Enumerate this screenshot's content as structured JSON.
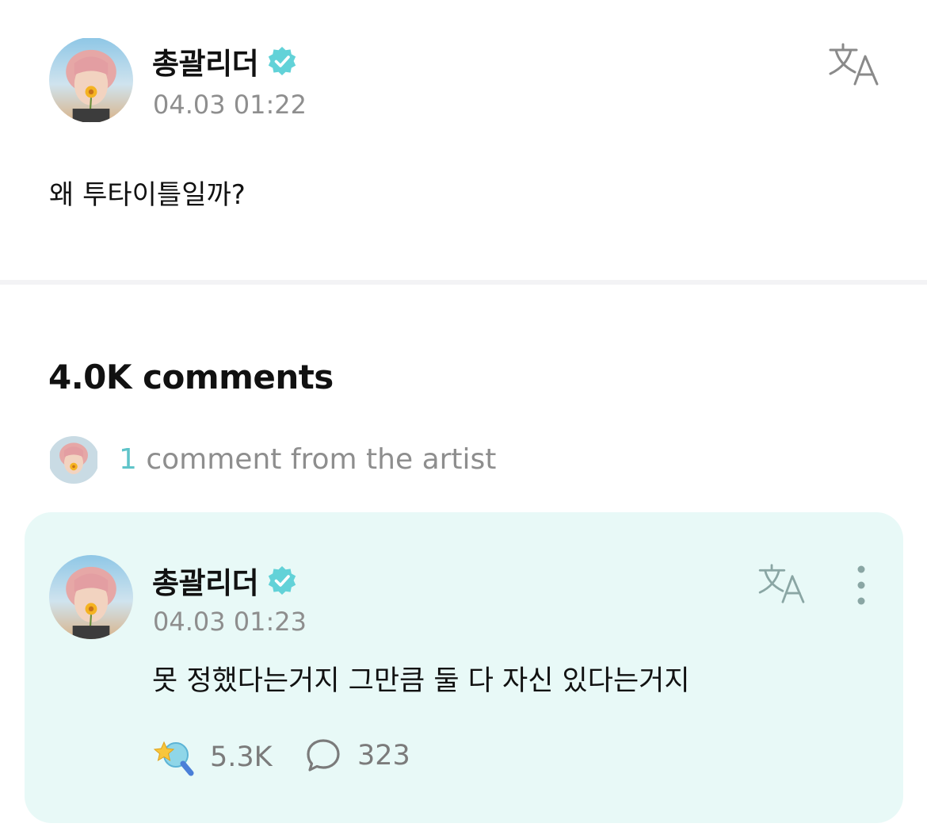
{
  "post": {
    "author": "총괄리더",
    "time": "04.03 01:22",
    "body": "왜 투타이틀일까?"
  },
  "comments": {
    "title": "4.0K comments",
    "artist_count": "1",
    "artist_label": " comment from the artist"
  },
  "artist_comment": {
    "author": "총괄리더",
    "time": "04.03 01:23",
    "text": "못 정했다는거지 그만큼 둘 다 자신 있다는거지",
    "likes": "5.3K",
    "replies": "323"
  },
  "icons": {
    "verified": "verified-badge-icon",
    "translate": "translate-icon",
    "more": "more-vertical-icon",
    "like": "star-magnifier-like-icon",
    "reply": "speech-bubble-icon"
  },
  "colors": {
    "accent": "#5fc4c9",
    "card_background": "#e8f9f7",
    "muted_text": "#8e8e8e"
  }
}
